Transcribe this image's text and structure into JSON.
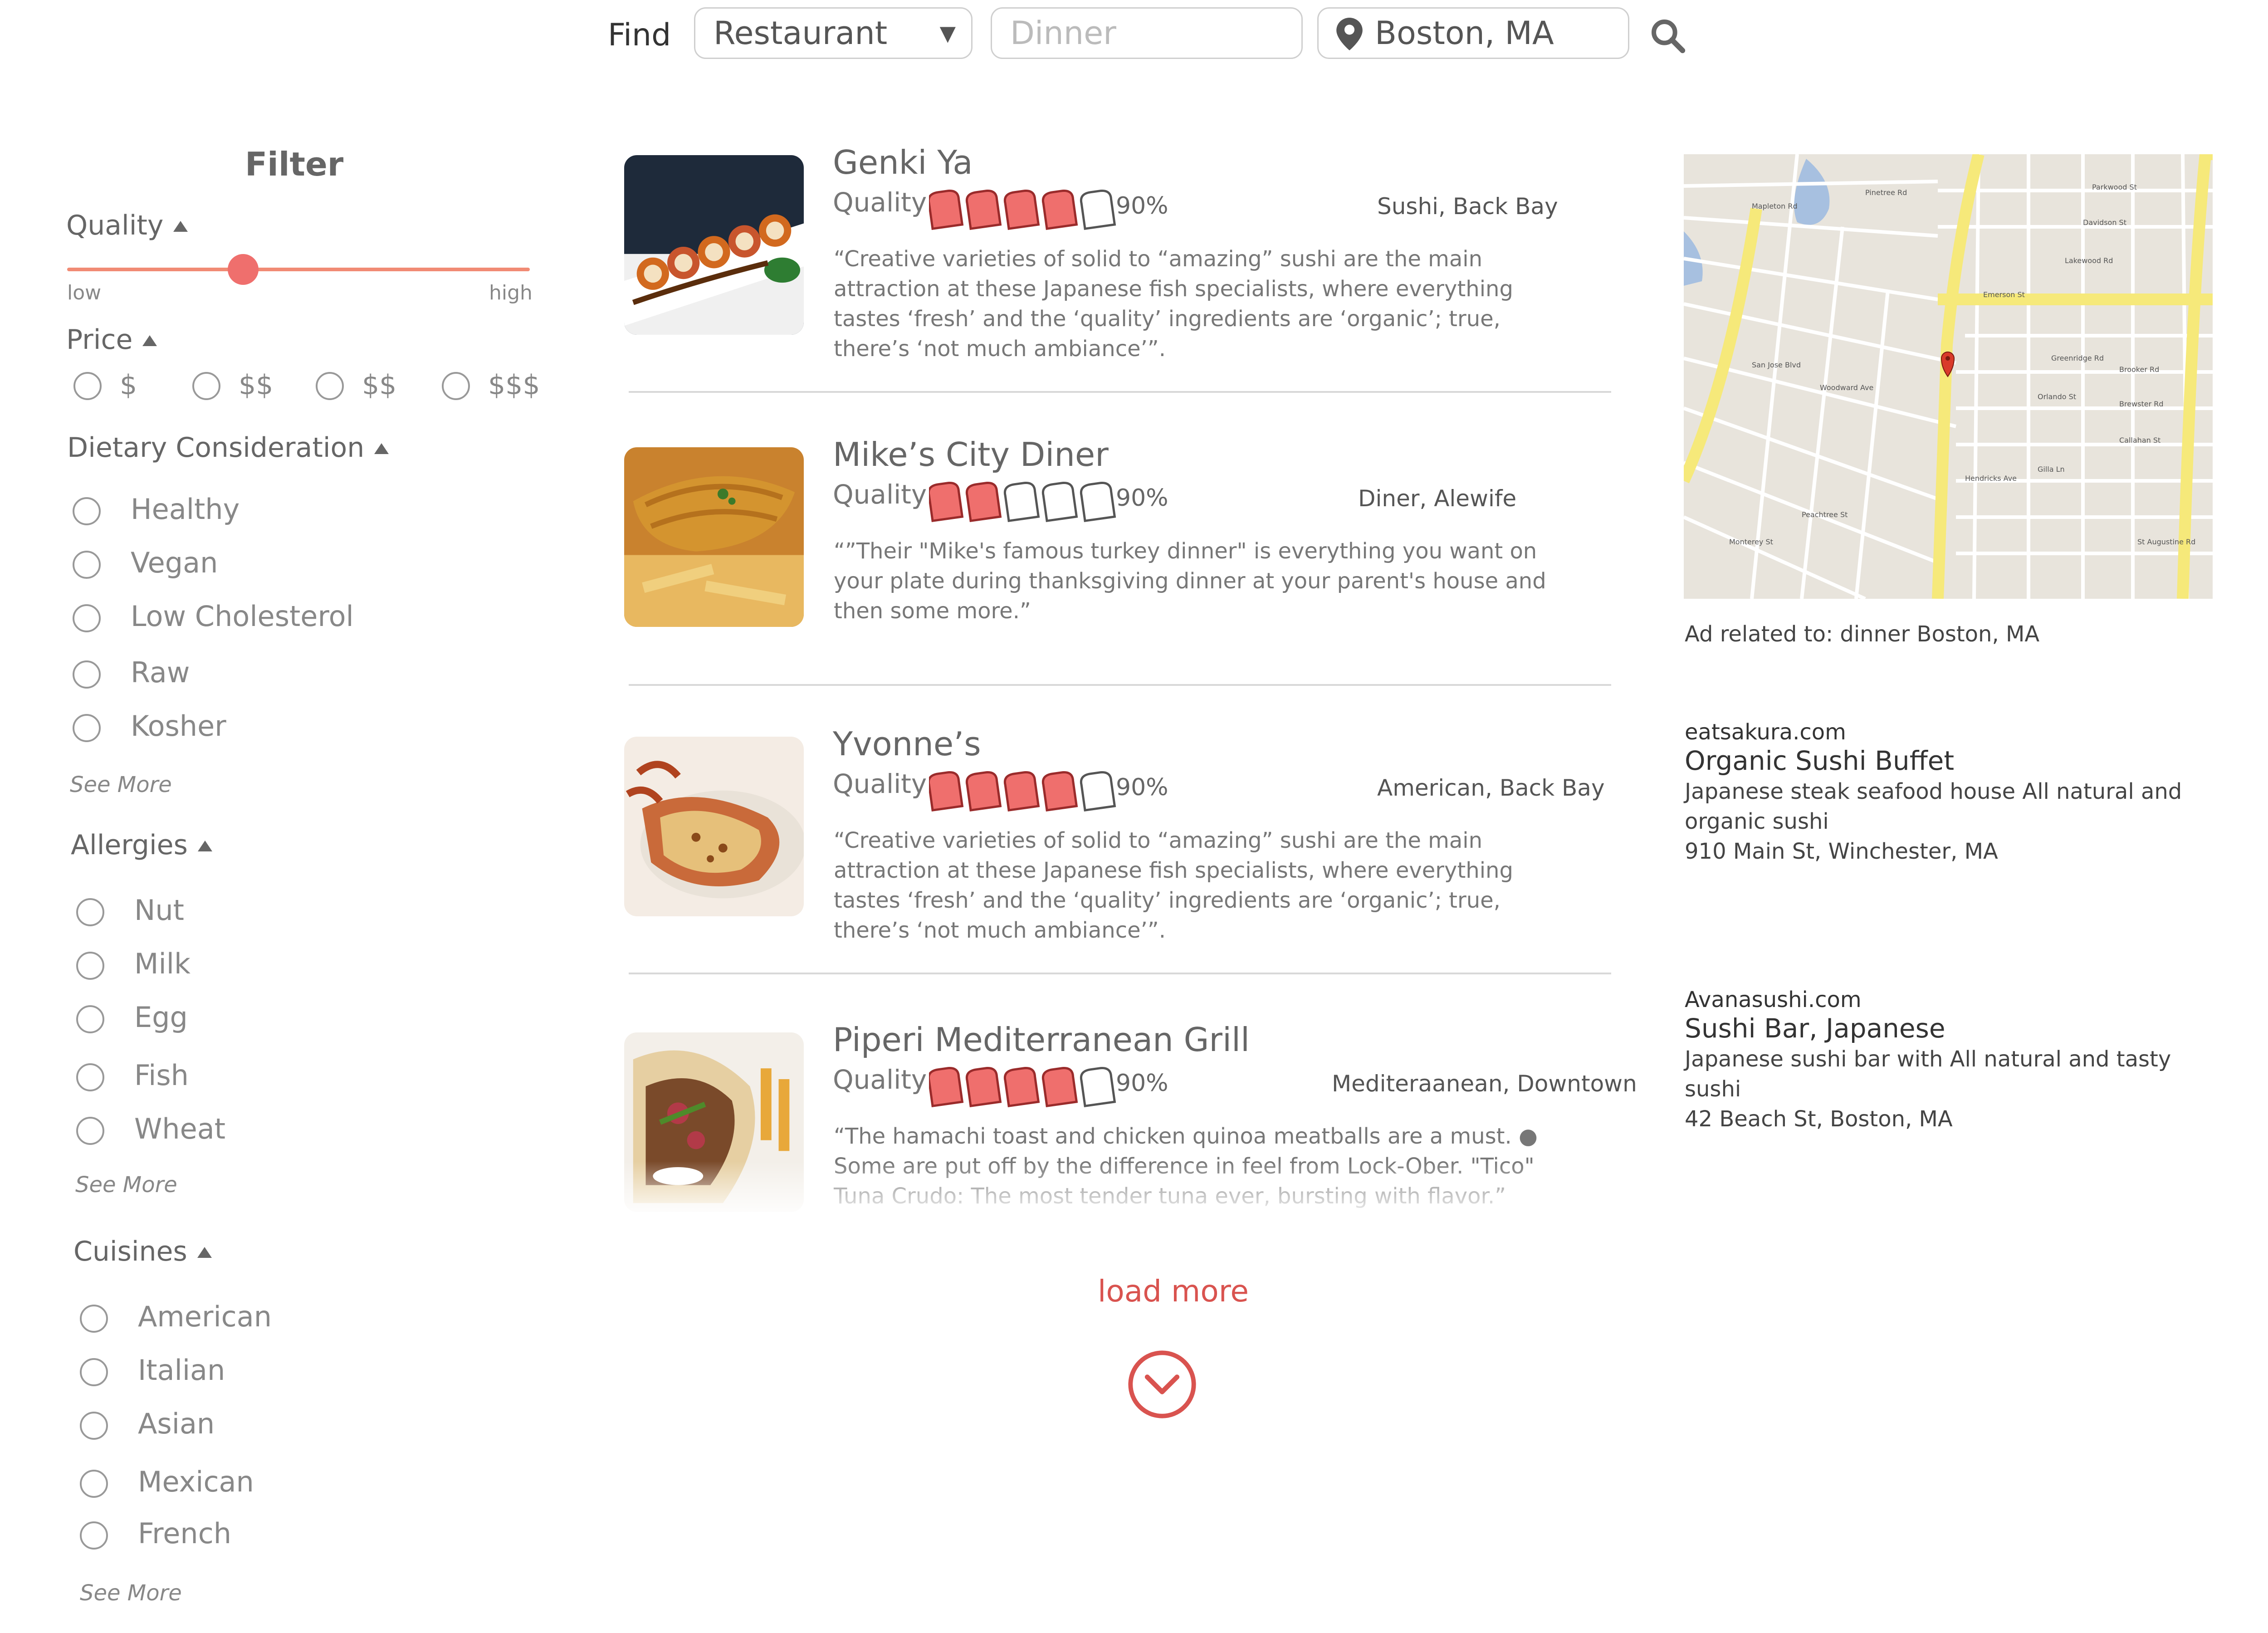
{
  "search": {
    "find_label": "Find",
    "category": "Restaurant",
    "term_placeholder": "Dinner",
    "location": "Boston, MA"
  },
  "filter": {
    "title": "Filter",
    "quality": {
      "title": "Quality",
      "low": "low",
      "high": "high",
      "value": 0.38
    },
    "price": {
      "title": "Price",
      "options": [
        "$",
        "$$",
        "$$",
        "$$$"
      ]
    },
    "dietary": {
      "title": "Dietary Consideration",
      "options": [
        "Healthy",
        "Vegan",
        "Low Cholesterol",
        "Raw",
        "Kosher"
      ],
      "see_more": "See More"
    },
    "allergies": {
      "title": "Allergies",
      "options": [
        "Nut",
        "Milk",
        "Egg",
        "Fish",
        "Wheat"
      ],
      "see_more": "See More"
    },
    "cuisines": {
      "title": "Cuisines",
      "options": [
        "American",
        "Italian",
        "Asian",
        "Mexican",
        "French"
      ],
      "see_more": "See More"
    }
  },
  "results": [
    {
      "name": "Genki Ya",
      "quality_label": "Quality",
      "rating": 4,
      "rating_max": 5,
      "percent": "90%",
      "category": "Sushi, Back Bay",
      "desc": "“Creative varieties of solid to “amazing” sushi are the main attraction at these Japanese fish specialists, where everything tastes ‘fresh’ and the ‘quality’ ingredients are ‘organic’; true, there’s ‘not much ambiance’”."
    },
    {
      "name": "Mike’s City Diner",
      "quality_label": "Quality",
      "rating": 2,
      "rating_max": 5,
      "percent": "90%",
      "category": "Diner, Alewife",
      "desc": "“”Their \"Mike's famous turkey dinner\" is everything you want on your plate during thanksgiving dinner at your parent's house and then some more.”"
    },
    {
      "name": "Yvonne’s",
      "quality_label": "Quality",
      "rating": 4,
      "rating_max": 5,
      "percent": "90%",
      "category": "American, Back Bay",
      "desc": "“Creative varieties of solid to “amazing” sushi are the main attraction at these Japanese fish specialists, where everything tastes ‘fresh’ and the ‘quality’ ingredients are ‘organic’; true, there’s ‘not much ambiance’”."
    },
    {
      "name": "Piperi Mediterranean Grill",
      "quality_label": "Quality",
      "rating": 4,
      "rating_max": 5,
      "percent": "90%",
      "category": "Mediteraanean, Downtown",
      "desc": "“The hamachi toast and chicken quinoa meatballs are a must.  ●  Some are put off by the difference in feel from Lock-Ober. \"Tico\" Tuna Crudo: The most tender tuna ever, bursting with flavor.”"
    }
  ],
  "load_more": "load more",
  "ads": {
    "related": "Ad related to: dinner Boston, MA",
    "items": [
      {
        "domain": "eatsakura.com",
        "title": "Organic Sushi Buffet",
        "desc": "Japanese steak seafood house All natural and organic sushi",
        "address": "910 Main St, Winchester, MA"
      },
      {
        "domain": "Avanasushi.com",
        "title": "Sushi Bar, Japanese",
        "desc": "Japanese sushi bar with All natural and tasty sushi",
        "address": "42 Beach St, Boston, MA"
      }
    ]
  },
  "map": {
    "streets": [
      "Emerson St",
      "Parkwood St",
      "Davidson St",
      "Lakewood Rd",
      "Greenridge Rd",
      "Brooker Rd",
      "Brewster Rd",
      "Callahan St",
      "Orlando St",
      "Gilla Ln",
      "Hendricks Ave",
      "San Jose Blvd",
      "St Augustine Rd",
      "Woodward Ave",
      "Pinetree Rd",
      "Mapleton Rd",
      "Monterey St",
      "Peachtree St"
    ],
    "colors": {
      "road_major": "#f6e97a",
      "road_minor": "#ffffff",
      "land": "#e8e4dc",
      "water": "#a7c0e0"
    }
  },
  "colors": {
    "accent": "#d9534f",
    "star_fill": "#ef6f6d",
    "slider": "#f18b74"
  }
}
